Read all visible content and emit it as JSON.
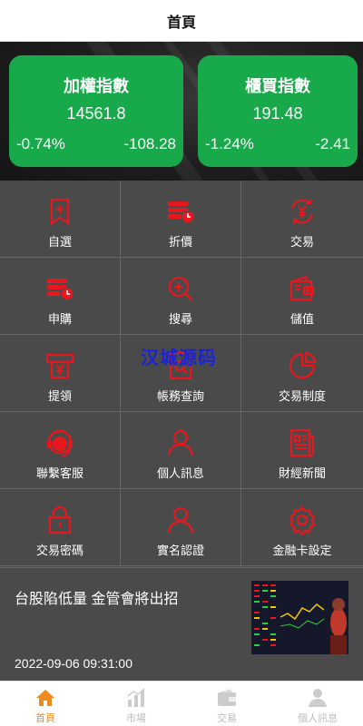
{
  "header": {
    "title": "首頁"
  },
  "indices": [
    {
      "name": "加權指數",
      "value": "14561.8",
      "percent": "-0.74%",
      "change": "-108.28"
    },
    {
      "name": "櫃買指數",
      "value": "191.48",
      "percent": "-1.24%",
      "change": "-2.41"
    }
  ],
  "menu": [
    {
      "label": "自選",
      "icon": "bookmark-plus-icon"
    },
    {
      "label": "折價",
      "icon": "coins-clock-icon"
    },
    {
      "label": "交易",
      "icon": "yen-exchange-icon"
    },
    {
      "label": "申購",
      "icon": "coins-clock-icon"
    },
    {
      "label": "搜尋",
      "icon": "search-plus-icon"
    },
    {
      "label": "儲值",
      "icon": "wallet-icon"
    },
    {
      "label": "提領",
      "icon": "atm-yen-icon"
    },
    {
      "label": "帳務查詢",
      "icon": "search-document-icon"
    },
    {
      "label": "交易制度",
      "icon": "pie-chart-icon"
    },
    {
      "label": "聯繫客服",
      "icon": "headset-icon"
    },
    {
      "label": "個人訊息",
      "icon": "user-icon"
    },
    {
      "label": "財經新聞",
      "icon": "newspaper-icon"
    },
    {
      "label": "交易密碼",
      "icon": "lock-icon"
    },
    {
      "label": "實名認證",
      "icon": "user-icon"
    },
    {
      "label": "金融卡設定",
      "icon": "gear-icon"
    }
  ],
  "watermark": "汉城源码",
  "news": {
    "headline": "台股陷低量 金管會將出招",
    "time": "2022-09-06 09:31:00"
  },
  "tabs": [
    {
      "label": "首頁",
      "icon": "home-icon",
      "active": true
    },
    {
      "label": "市場",
      "icon": "chart-icon",
      "active": false
    },
    {
      "label": "交易",
      "icon": "wallet-icon",
      "active": false
    },
    {
      "label": "個人訊息",
      "icon": "user-icon",
      "active": false
    }
  ],
  "colors": {
    "accent": "#f08a1e",
    "card_green": "#17a94a",
    "icon_red": "#e8171e",
    "tab_inactive": "#bbbbbb"
  }
}
